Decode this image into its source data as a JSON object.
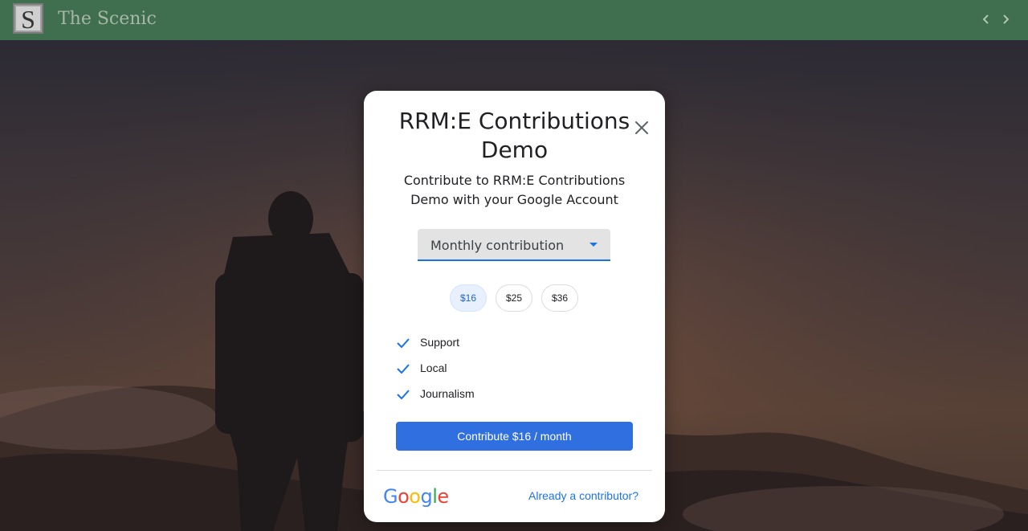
{
  "header": {
    "logo_letter": "S",
    "site_title": "The Scenic",
    "prev_icon": "chevron-left-icon",
    "next_icon": "chevron-right-icon"
  },
  "dialog": {
    "title": "RRM:E Contributions Demo",
    "subtitle": "Contribute to RRM:E Contributions Demo with your Google Account",
    "close_icon": "close-icon",
    "frequency_select": {
      "selected": "Monthly contribution"
    },
    "amounts": [
      {
        "label": "$16",
        "selected": true
      },
      {
        "label": "$25",
        "selected": false
      },
      {
        "label": "$36",
        "selected": false
      }
    ],
    "benefits": [
      "Support",
      "Local",
      "Journalism"
    ],
    "cta_label": "Contribute $16 / month",
    "footer": {
      "brand": "Google",
      "already_contributor": "Already a contributor?"
    }
  },
  "colors": {
    "header_bg": "#3f6f4e",
    "accent": "#1a73e8",
    "cta_bg": "#2f6fe0",
    "chip_selected_bg": "#e8f0fe"
  }
}
